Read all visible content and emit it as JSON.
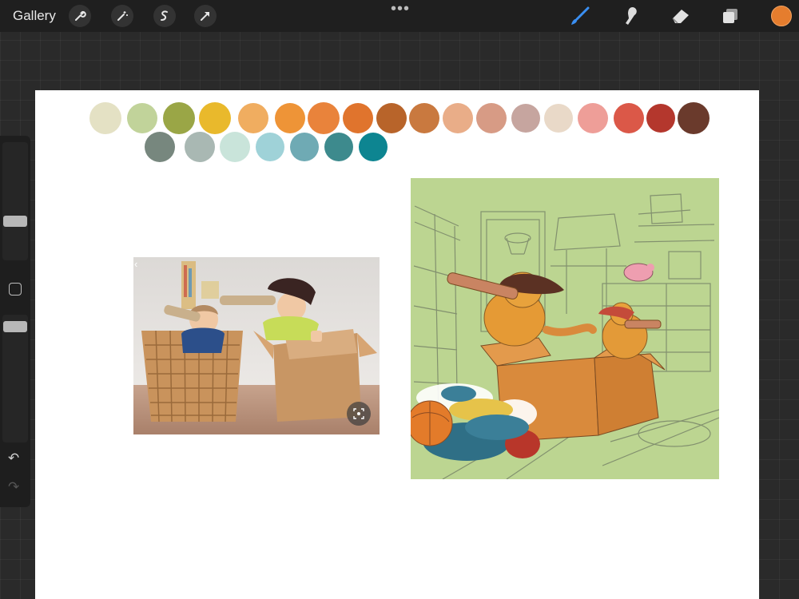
{
  "toolbar": {
    "gallery_label": "Gallery",
    "left_tools": [
      "wrench-icon",
      "magic-wand-icon",
      "selection-icon",
      "transform-arrow-icon"
    ],
    "more_dots": "•••",
    "right_tools": [
      "brush-icon",
      "smudge-icon",
      "eraser-icon",
      "layers-icon"
    ],
    "current_color": "#e57d2e"
  },
  "sidebar": {
    "undo_icon": "↶",
    "redo_icon": "↷"
  },
  "reference": {
    "back_glyph": "‹"
  },
  "palette": {
    "row1": [
      "#e4e1c4",
      "#c1d39a",
      "#9aa646",
      "#e9b92c",
      "#f0ad60",
      "#ee9437",
      "#e9833b",
      "#e0742d",
      "#b8642a",
      "#c9793f",
      "#e9ad88",
      "#d79b85",
      "#c6a59f",
      "#e9d9c8",
      "#ee9e98",
      "#db5848",
      "#b4372d",
      "#6a3a2c"
    ],
    "row2": [
      "#77877e",
      "#a9b8b3",
      "#c9e4da",
      "#9fd2d8",
      "#6faab4",
      "#3d8a8d",
      "#0d8591"
    ]
  }
}
